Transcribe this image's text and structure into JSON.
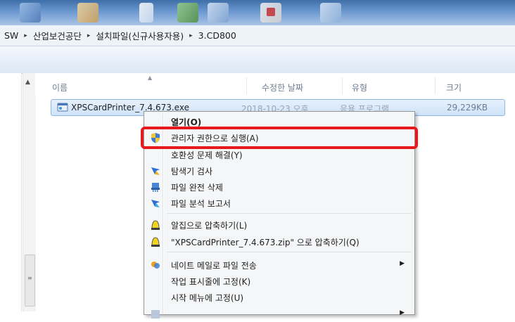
{
  "address_bar": {
    "crumbs": [
      "SW",
      "산업보건공단",
      "설치파일(신규사용자용)",
      "3.CD800"
    ],
    "separator": "▸"
  },
  "columns": {
    "name": "이름",
    "date": "수정한 날짜",
    "type": "유형",
    "size": "크기"
  },
  "file": {
    "name": "XPSCardPrinter_7.4.673.exe",
    "date": "2018-10-23 오후",
    "type": "응용 프로그램",
    "size": "29,229KB"
  },
  "context_menu": {
    "open": "열기(O)",
    "run_as_admin": "관리자 권한으로 실행(A)",
    "troubleshoot_compat": "호환성 문제 해결(Y)",
    "explorer_scan": "탐색기 검사",
    "shred": "파일 완전 삭제",
    "file_report": "파일 분석 보고서",
    "zip_compress": "알집으로 압축하기(L)",
    "zip_named": "\"XPSCardPrinter_7.4.673.zip\" 으로 압축하기(Q)",
    "send_mail": "네이트 메일로 파일 전송",
    "pin_taskbar": "작업 표시줄에 고정(K)",
    "pin_start": "시작 메뉴에 고정(U)",
    "submenu_arrow": "▶"
  },
  "icons": {
    "file_icon": "application-exe-icon",
    "shield": "uac-shield-icon",
    "alzip": "alzip-icon"
  },
  "colors": {
    "highlight": "#e8191c",
    "selection": "#cfe3fa"
  }
}
